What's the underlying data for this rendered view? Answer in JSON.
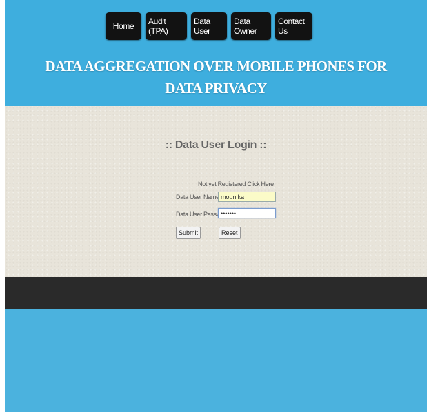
{
  "nav": {
    "items": [
      {
        "label": "Home"
      },
      {
        "label": "Audit (TPA)"
      },
      {
        "label": "Data User"
      },
      {
        "label": "Data Owner"
      },
      {
        "label": "Contact Us"
      }
    ]
  },
  "header": {
    "title_line1": "DATA AGGREGATION OVER MOBILE PHONES FOR",
    "title_line2": "DATA PRIVACY"
  },
  "login": {
    "title": ":: Data User Login ::",
    "register_link": "Not yet Registered Click Here",
    "username_label": "Data User Name",
    "username_value": "mounika",
    "password_label": "Data User Password",
    "password_value": "•••••••",
    "submit_label": "Submit",
    "reset_label": "Reset"
  },
  "colors": {
    "header_bg": "#3eaede",
    "content_bg": "#e8e4da",
    "footer_bg": "#2a2a2a",
    "nav_button_bg": "#121212"
  }
}
